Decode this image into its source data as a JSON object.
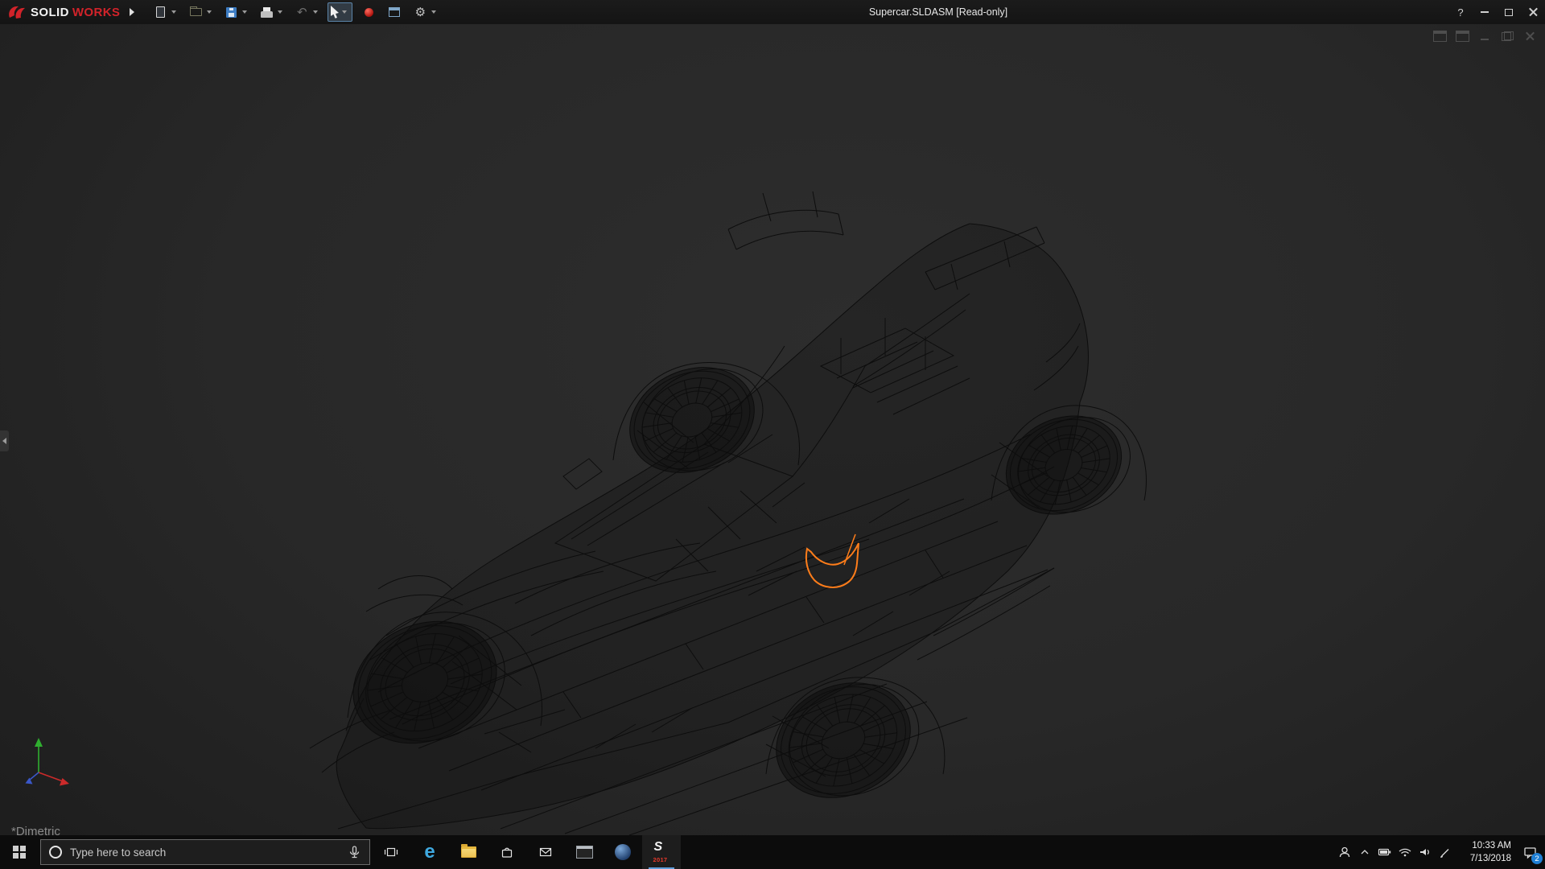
{
  "colors": {
    "brand_red": "#d2232a",
    "selection_orange": "#ff7d1a",
    "axis_x": "#cc2a2a",
    "axis_y": "#2fae2f",
    "axis_z": "#3a57c8",
    "badge_blue": "#1f7fd4",
    "edge_blue": "#3fa9e0",
    "sw_year_red": "#e8392b"
  },
  "titlebar": {
    "brand_solid": "SOLID",
    "brand_works": "WORKS",
    "title": "Supercar.SLDASM [Read-only]",
    "help_label": "?"
  },
  "toolbar": {
    "tools": [
      "new-document",
      "open",
      "save",
      "print",
      "undo",
      "select",
      "record-macro",
      "task-pane",
      "options"
    ],
    "glyph_undo": "↶",
    "glyph_gear": "⚙"
  },
  "viewport": {
    "view_label": "*Dimetric",
    "window_controls": [
      "pane-left",
      "pane-right",
      "minimize",
      "restore",
      "close"
    ],
    "selected_component_color": "#ff7d1a"
  },
  "taskbar": {
    "search_placeholder": "Type here to search",
    "apps": [
      "task-view",
      "microsoft-edge",
      "file-explorer",
      "microsoft-store",
      "mail",
      "command-prompt",
      "edrawings",
      "solidworks-2017"
    ],
    "tray_icons": [
      "people",
      "hidden-icons-chevron",
      "battery",
      "network",
      "volume",
      "pen"
    ],
    "edge_letter": "e",
    "solidworks_icon_letter": "S",
    "solidworks_icon_year": "2017",
    "time": "10:33 AM",
    "date": "7/13/2018",
    "notification_count": "2"
  }
}
